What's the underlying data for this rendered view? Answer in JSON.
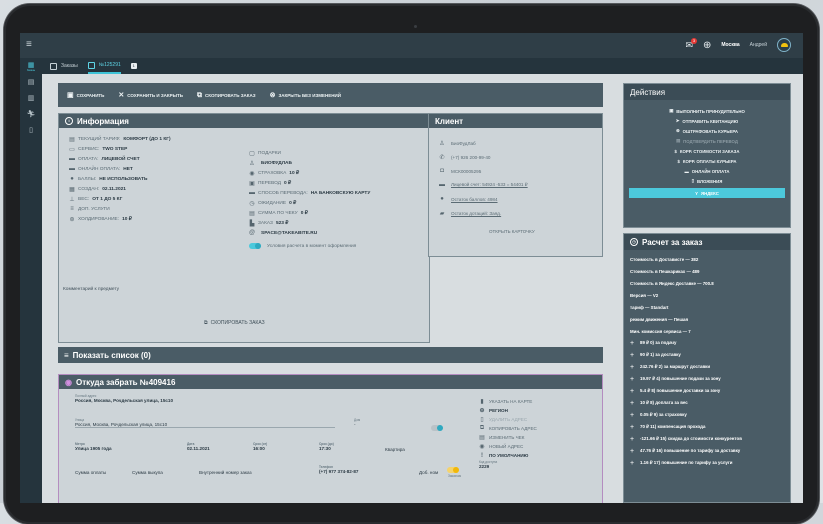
{
  "topbar": {
    "notifications_count": "3",
    "city": "Москва",
    "user_name": "Андрей"
  },
  "tabs": [
    {
      "label": "Заказы"
    },
    {
      "label": "№125291"
    },
    {
      "label": "1"
    }
  ],
  "toolbar": {
    "save": "СОХРАНИТЬ",
    "save_close": "СОХРАНИТЬ И ЗАКРЫТЬ",
    "copy_order": "СКОПИРОВАТЬ ЗАКАЗ",
    "close_no_save": "ЗАКРЫТЬ БЕЗ ИЗМЕНЕНИЙ"
  },
  "info": {
    "title": "Информация",
    "left": [
      {
        "label": "ТЕКУЩИЙ ТАРИФ:",
        "value": "КОМФОРТ (ДО 1 КГ)"
      },
      {
        "label": "СЕРВИС:",
        "value": "TWO STEP"
      },
      {
        "label": "ОПЛАТА:",
        "value": "ЛИЦЕВОЙ СЧЕТ"
      },
      {
        "label": "ОНЛАЙН ОПЛАТА:",
        "value": "НЕТ"
      },
      {
        "label": "БАЛЛЫ:",
        "value": "НЕ ИСПОЛЬЗОВАТЬ"
      },
      {
        "label": "СОЗДАН:",
        "value": "02.11.2021"
      },
      {
        "label": "ВЕС:",
        "value": "ОТ 1 ДО 5 КГ"
      },
      {
        "label": "ДОП. УСЛУГИ",
        "value": ""
      },
      {
        "label": "ХОЛДИРОВАНИЕ:",
        "value": "10 ₽"
      }
    ],
    "right": [
      {
        "label": "ПОДАРКИ",
        "value": ""
      },
      {
        "label": "",
        "value": "БИОФУДЛАБ"
      },
      {
        "label": "СТРАХОВКА",
        "value": "10 ₽"
      },
      {
        "label": "ПЕРЕВОД",
        "value": "0 ₽"
      },
      {
        "label": "СПОСОБ ПЕРЕВОДА:",
        "value": "НА БАНКОВСКУЮ КАРТУ"
      },
      {
        "label": "ОЖИДАНИЕ",
        "value": "0 ₽"
      },
      {
        "label": "СУММА ПО ЧЕКУ",
        "value": "0 ₽"
      },
      {
        "label": "ЗАКАЗ",
        "value": "523 ₽"
      },
      {
        "label": "",
        "value": "SPACE@TAKEABITE.RU"
      }
    ],
    "toggle_label": "Условия расчета в момент оформления",
    "comment_label": "Комментарий к предмету",
    "copy_order_btn": "СКОПИРОВАТЬ ЗАКАЗ"
  },
  "client": {
    "title": "Клиент",
    "rows": [
      {
        "text": "БиоФудЛаб"
      },
      {
        "text": "(+7) 926 200-99-40"
      },
      {
        "text": "МСК00005295"
      },
      {
        "text": "Лицевой счет: 54924 -533 = 54401 ₽"
      },
      {
        "text": "Остаток баллов: 4984"
      },
      {
        "text": "Остаток дотаций: Заяд."
      }
    ],
    "open_card": "ОТКРЫТЬ КАРТОЧКУ"
  },
  "show_list": "Показать список (0)",
  "pickup": {
    "title": "Откуда забрать №409416",
    "full_address_label": "Полный адрес",
    "full_address": "Россия, Москва, Рочдельская улица, 15с10",
    "street_label": "Улица",
    "street": "Россия, Москва, Рочдельская улица, 15с10",
    "house_label": "Дом",
    "house": "-",
    "metro_label": "Метро",
    "metro": "Улица 1905 года",
    "date_label": "Дата",
    "date": "02.11.2021",
    "time_from_label": "Срок (от)",
    "time_from": "16:00",
    "time_to_label": "Срок (до)",
    "time_to": "17:30",
    "flat": "Квартира",
    "pay_sum": "Сумма оплаты",
    "buyout_sum": "Сумма выкупа",
    "internal_no": "Внутренний номер заказ",
    "phone_label": "Телефон",
    "phone": "(+7) 977 374-82-87",
    "ext": "Доб. ном",
    "gate_code_label": "Код доступа",
    "gate_code": "2229",
    "ask_label": "Заказчик",
    "side": [
      {
        "text": "УКАЗАТЬ НА КАРТЕ",
        "style": "normal"
      },
      {
        "text": "РЕГИОН",
        "style": "dark"
      },
      {
        "text": "УДАЛИТЬ АДРЕС",
        "style": "faded"
      },
      {
        "text": "КОПИРОВАТЬ АДРЕС",
        "style": "normal"
      },
      {
        "text": "ИЗМЕНИТЬ ЧЕК",
        "style": "normal"
      },
      {
        "text": "НОВЫЙ АДРЕС",
        "style": "normal"
      },
      {
        "text": "ПО УМОЛЧАНИЮ",
        "style": "dark"
      }
    ]
  },
  "actions": {
    "title": "Действия",
    "items": [
      {
        "text": "ВЫПОЛНИТЬ ПРИНУДИТЕЛЬНО",
        "style": "normal"
      },
      {
        "text": "ОТПРАВИТЬ КВИТАНЦИЮ",
        "style": "normal"
      },
      {
        "text": "ОШТРАФОВАТЬ КУРЬЕРА",
        "style": "normal"
      },
      {
        "text": "ПОДТВЕРДИТЬ ПЕРЕВОД",
        "style": "faded"
      },
      {
        "text": "КОРР. СТОИМОСТИ ЗАКАЗА",
        "style": "normal"
      },
      {
        "text": "КОРР. ОПЛАТЫ КУРЬЕРА",
        "style": "normal"
      },
      {
        "text": "ОНЛАЙН ОПЛАТА",
        "style": "normal"
      },
      {
        "text": "ВЛОЖЕНИЯ",
        "style": "normal"
      },
      {
        "text": "ЯНДЕКС",
        "style": "hl"
      }
    ]
  },
  "calc": {
    "title": "Расчет за заказ",
    "header_rows": [
      "Стоимость в Достависте — 382",
      "Стоимость в Пешкариках — 489",
      "Стоимость в Яндекс Доставке — 700.8",
      "Версия — V2",
      "тариф — Standart",
      "режим движения — Пешая",
      "Мин. комиссия сервиса — 7"
    ],
    "rows": [
      "89 ₽   0) за подачу",
      "90 ₽   1) за доставку",
      "242.76 ₽   2) за маршрут доставки",
      "19.97 ₽   4) повышение подачи за зону",
      "5.4 ₽   8) повышение доставки за зону",
      "10 ₽   8) доплата за вес",
      "0.05 ₽   9) за страховку",
      "70 ₽   11) компенсация прохода",
      "-121.66 ₽   15) скидка до стоимости конкурентов",
      "47.76 ₽   16) повышение по тарифу за доставку",
      "1.16 ₽   17) повышение по тарифу за услуги"
    ]
  }
}
